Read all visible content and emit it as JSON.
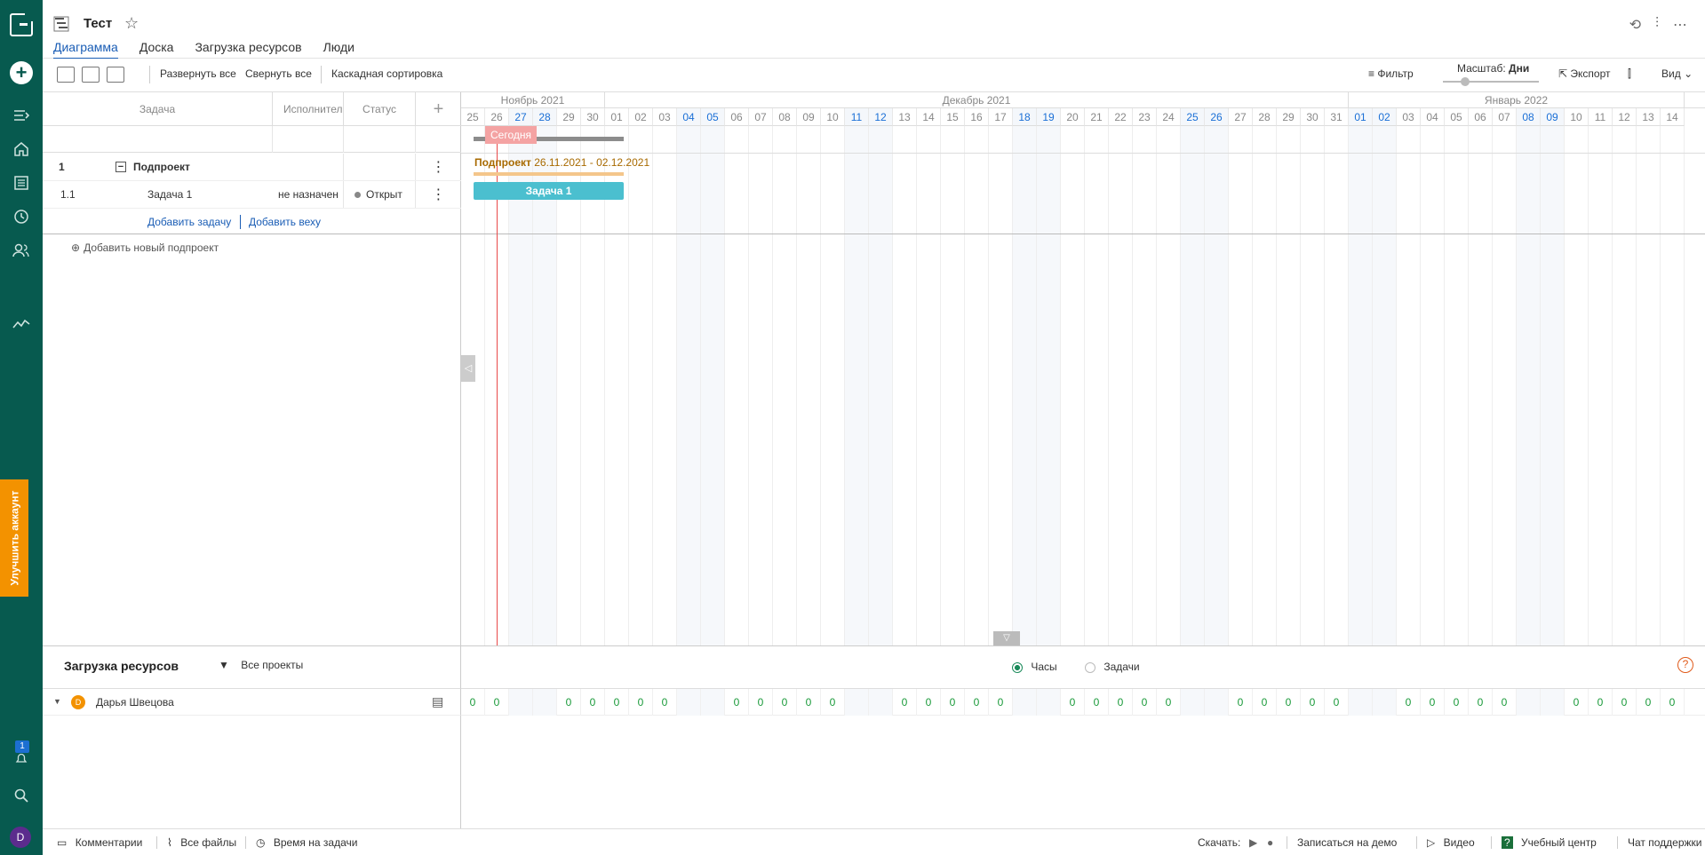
{
  "app": {
    "title": "Тест",
    "tabs": [
      {
        "label": "Диаграмма",
        "active": true
      },
      {
        "label": "Доска",
        "active": false
      },
      {
        "label": "Загрузка ресурсов",
        "active": false
      },
      {
        "label": "Люди",
        "active": false
      }
    ]
  },
  "sidebar": {
    "upgrade_label": "Улучшить аккаунт",
    "notif_count": "1",
    "avatar_letter": "D"
  },
  "toolbar": {
    "expand_all": "Развернуть все",
    "collapse_all": "Свернуть все",
    "cascade_sort": "Каскадная сортировка",
    "filter": "Фильтр",
    "scale_label": "Масштаб:",
    "scale_value": "Дни",
    "export": "Экспорт",
    "view": "Вид"
  },
  "grid": {
    "headers": {
      "task": "Задача",
      "assignee": "Исполнитель",
      "status": "Статус"
    },
    "subproject": {
      "num": "1",
      "name": "Подпроект"
    },
    "task": {
      "num": "1.1",
      "name": "Задача 1",
      "assignee": "не назначен",
      "status": "Открыт"
    },
    "add_task": "Добавить задачу",
    "add_milestone": "Добавить веху",
    "add_subproject": "Добавить новый подпроект"
  },
  "timeline": {
    "months": [
      {
        "label": "Ноябрь 2021",
        "days": 6
      },
      {
        "label": "Декабрь 2021",
        "days": 31
      },
      {
        "label": "Январь 2022",
        "days": 14
      }
    ],
    "days": [
      "25",
      "26",
      "27",
      "28",
      "29",
      "30",
      "01",
      "02",
      "03",
      "04",
      "05",
      "06",
      "07",
      "08",
      "09",
      "10",
      "11",
      "12",
      "13",
      "14",
      "15",
      "16",
      "17",
      "18",
      "19",
      "20",
      "21",
      "22",
      "23",
      "24",
      "25",
      "26",
      "27",
      "28",
      "29",
      "30",
      "31",
      "01",
      "02",
      "03",
      "04",
      "05",
      "06",
      "07",
      "08",
      "09",
      "10",
      "11",
      "12",
      "13",
      "14"
    ],
    "weekend_idx": [
      2,
      3,
      9,
      10,
      16,
      17,
      23,
      24,
      30,
      31,
      37,
      38,
      44,
      45
    ],
    "today_label": "Сегодня",
    "today_idx": 1,
    "project_bar": {
      "label": "Подпроект",
      "dates": "26.11.2021 - 02.12.2021",
      "start_idx": 1,
      "end_idx": 7
    },
    "task_bar": {
      "label": "Задача 1",
      "start_idx": 1,
      "end_idx": 7
    }
  },
  "resources": {
    "title": "Загрузка ресурсов",
    "projects_filter": "Все проекты",
    "mode_hours": "Часы",
    "mode_tasks": "Задачи",
    "person": {
      "initial": "D",
      "name": "Дарья Швецова",
      "load": "0"
    }
  },
  "footer": {
    "comments": "Комментарии",
    "files": "Все файлы",
    "time": "Время на задачи",
    "download": "Скачать:",
    "demo": "Записаться на демо",
    "video": "Видео",
    "learning": "Учебный центр",
    "support": "Чат поддержки"
  },
  "colors": {
    "sidebar": "#075a4f",
    "accent": "#1a5db5",
    "task_bar": "#4bbfcf",
    "today": "#e84a4a",
    "upgrade": "#f39200"
  }
}
